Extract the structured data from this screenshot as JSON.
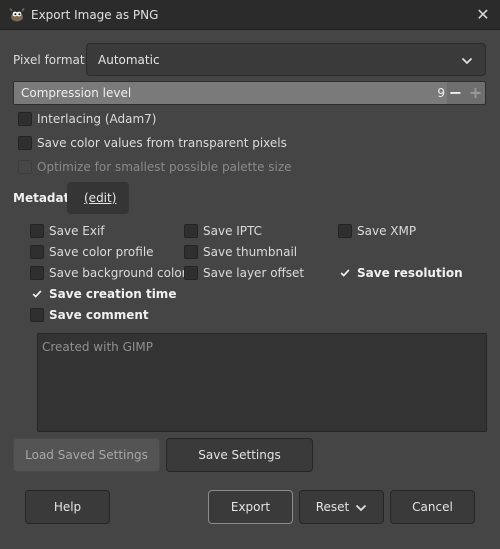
{
  "window": {
    "title": "Export Image as PNG",
    "close_glyph": "✕",
    "icon": "gimp-wilber-icon"
  },
  "pixel_format": {
    "label": "Pixel format",
    "value": "Automatic"
  },
  "compression": {
    "label": "Compression level",
    "value": "9",
    "max": 9,
    "minus": "−",
    "plus": "+"
  },
  "options": [
    {
      "id": "interlacing",
      "label": "Interlacing (Adam7)",
      "checked": false,
      "disabled": false
    },
    {
      "id": "save-transparent",
      "label": "Save color values from transparent pixels",
      "checked": false,
      "disabled": false
    },
    {
      "id": "optimize-palette",
      "label": "Optimize for smallest possible palette size",
      "checked": false,
      "disabled": true
    }
  ],
  "metadata": {
    "title": "Metadata",
    "edit_label": "(edit)",
    "items": [
      {
        "id": "exif",
        "label": "Save Exif",
        "checked": false,
        "bold": false
      },
      {
        "id": "iptc",
        "label": "Save IPTC",
        "checked": false,
        "bold": false
      },
      {
        "id": "xmp",
        "label": "Save XMP",
        "checked": false,
        "bold": false
      },
      {
        "id": "color-profile",
        "label": "Save color profile",
        "checked": false,
        "bold": false
      },
      {
        "id": "thumbnail",
        "label": "Save thumbnail",
        "checked": false,
        "bold": false
      },
      {
        "id": "bg-color",
        "label": "Save background color",
        "checked": false,
        "bold": false
      },
      {
        "id": "layer-offset",
        "label": "Save layer offset",
        "checked": false,
        "bold": false
      },
      {
        "id": "resolution",
        "label": "Save resolution",
        "checked": true,
        "bold": true
      },
      {
        "id": "creation-time",
        "label": "Save creation time",
        "checked": true,
        "bold": true
      },
      {
        "id": "comment",
        "label": "Save comment",
        "checked": false,
        "bold": true
      }
    ],
    "comment_text": "Created with GIMP"
  },
  "settings_buttons": {
    "load": "Load Saved Settings",
    "save": "Save Settings"
  },
  "footer": {
    "help": "Help",
    "export": "Export",
    "reset": "Reset",
    "cancel": "Cancel"
  },
  "colors": {
    "background": "#454545",
    "titlebar": "#2b2b2b",
    "field": "#3a3a3a",
    "check": "#f0f0f0"
  }
}
